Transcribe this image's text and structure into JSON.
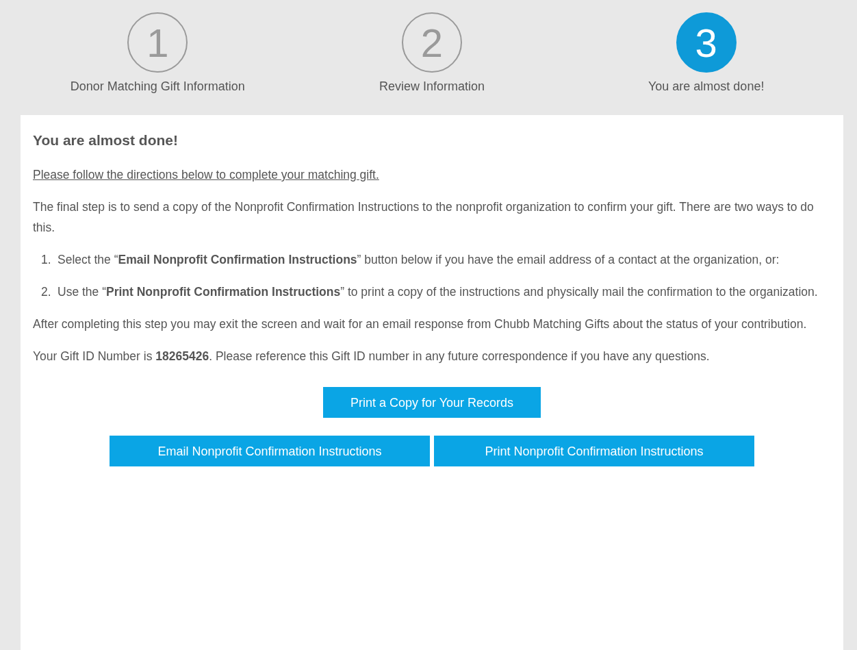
{
  "steps": [
    {
      "number": "1",
      "label": "Donor Matching Gift Information",
      "selected": false
    },
    {
      "number": "2",
      "label": "Review Information",
      "selected": false
    },
    {
      "number": "3",
      "label": "You are almost done!",
      "selected": true
    }
  ],
  "heading": "You are almost done!",
  "directions_link": "Please follow the directions below to complete your matching gift.",
  "intro": "The final step is to send a copy of the Nonprofit Confirmation Instructions to the nonprofit organization to confirm your gift. There are two ways to do this.",
  "options": [
    {
      "number": "1.",
      "text": "Select the “**Email Nonprofit Confirmation Instructions**” button below if you have the email address of a contact at the organization, or:"
    },
    {
      "number": "2.",
      "text": "Use the “**Print Nonprofit Confirmation Instructions**” to print a copy of the instructions and physically mail the confirmation to the organization."
    }
  ],
  "after": "After completing this step you may exit the screen and wait for an email response from Chubb Matching Gifts about the status of your contribution.",
  "gift_id": "Your Gift ID Number is **18265426**. Please reference this Gift ID number in any future correspondence if you have any questions.",
  "print_button": "Print a Copy for Your Records",
  "action_buttons": [
    "Email Nonprofit Confirmation Instructions",
    "Print Nonprofit Confirmation Instructions"
  ]
}
